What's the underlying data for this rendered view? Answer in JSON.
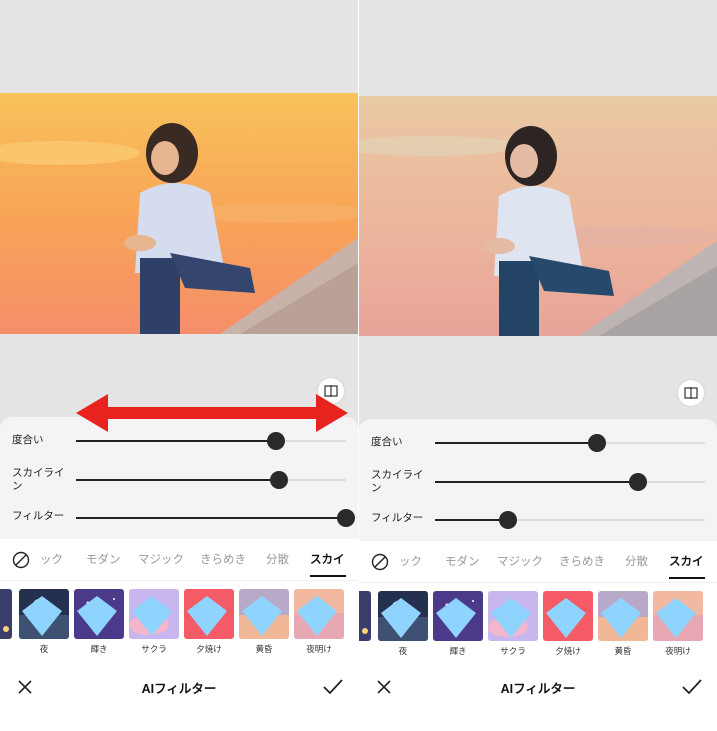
{
  "panels": [
    {
      "id": "left",
      "sliders": [
        {
          "label": "度合い",
          "value": 0.74
        },
        {
          "label": "スカイライン",
          "value": 0.75
        },
        {
          "label": "フィルター",
          "value": 1.0
        }
      ],
      "tabs": [
        "ック",
        "モダン",
        "マジック",
        "きらめき",
        "分散",
        "スカイ"
      ],
      "active_tab": "スカイ",
      "filters": [
        "夜",
        "輝き",
        "サクラ",
        "夕焼け",
        "黄昏",
        "夜明け"
      ],
      "title": "AIフィルター"
    },
    {
      "id": "right",
      "sliders": [
        {
          "label": "度合い",
          "value": 0.6
        },
        {
          "label": "スカイライン",
          "value": 0.75
        },
        {
          "label": "フィルター",
          "value": 0.27
        }
      ],
      "tabs": [
        "ック",
        "モダン",
        "マジック",
        "きらめき",
        "分散",
        "スカイ"
      ],
      "active_tab": "スカイ",
      "filters": [
        "夜",
        "輝き",
        "サクラ",
        "夕焼け",
        "黄昏",
        "夜明け"
      ],
      "title": "AIフィルター"
    }
  ],
  "colors": {
    "accent_arrow": "#e8231f",
    "sky_warm": "#f7a24e",
    "sky_muted": "#e9b79a"
  },
  "icons": {
    "compare": "compare-split-icon",
    "none": "no-filter-icon",
    "close": "close-icon",
    "confirm": "check-icon",
    "premium": "gem-icon"
  }
}
